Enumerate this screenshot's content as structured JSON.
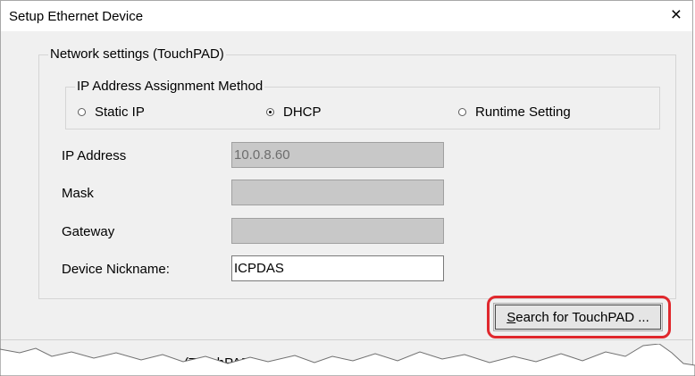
{
  "window": {
    "title": "Setup Ethernet Device",
    "close_glyph": "×"
  },
  "network_group": {
    "legend": "Network settings (TouchPAD)"
  },
  "ip_method_group": {
    "legend": "IP Address Assignment Method",
    "options": [
      {
        "label": "Static IP",
        "checked": false
      },
      {
        "label": "DHCP",
        "checked": true
      },
      {
        "label": "Runtime Setting",
        "checked": false
      }
    ]
  },
  "fields": {
    "ip_address": {
      "label": "IP Address",
      "value": "10.0.8.60",
      "enabled": false
    },
    "mask": {
      "label": "Mask",
      "value": "",
      "enabled": false
    },
    "gateway": {
      "label": "Gateway",
      "value": "",
      "enabled": false
    },
    "nickname": {
      "label": "Device Nickname:",
      "value": "ICPDAS",
      "enabled": true
    }
  },
  "search_button": {
    "accel": "S",
    "rest": "earch for TouchPAD ...",
    "highlight_color": "#e0282d"
  },
  "download_group": {
    "legend": "Download Information (TouchPAD)"
  }
}
